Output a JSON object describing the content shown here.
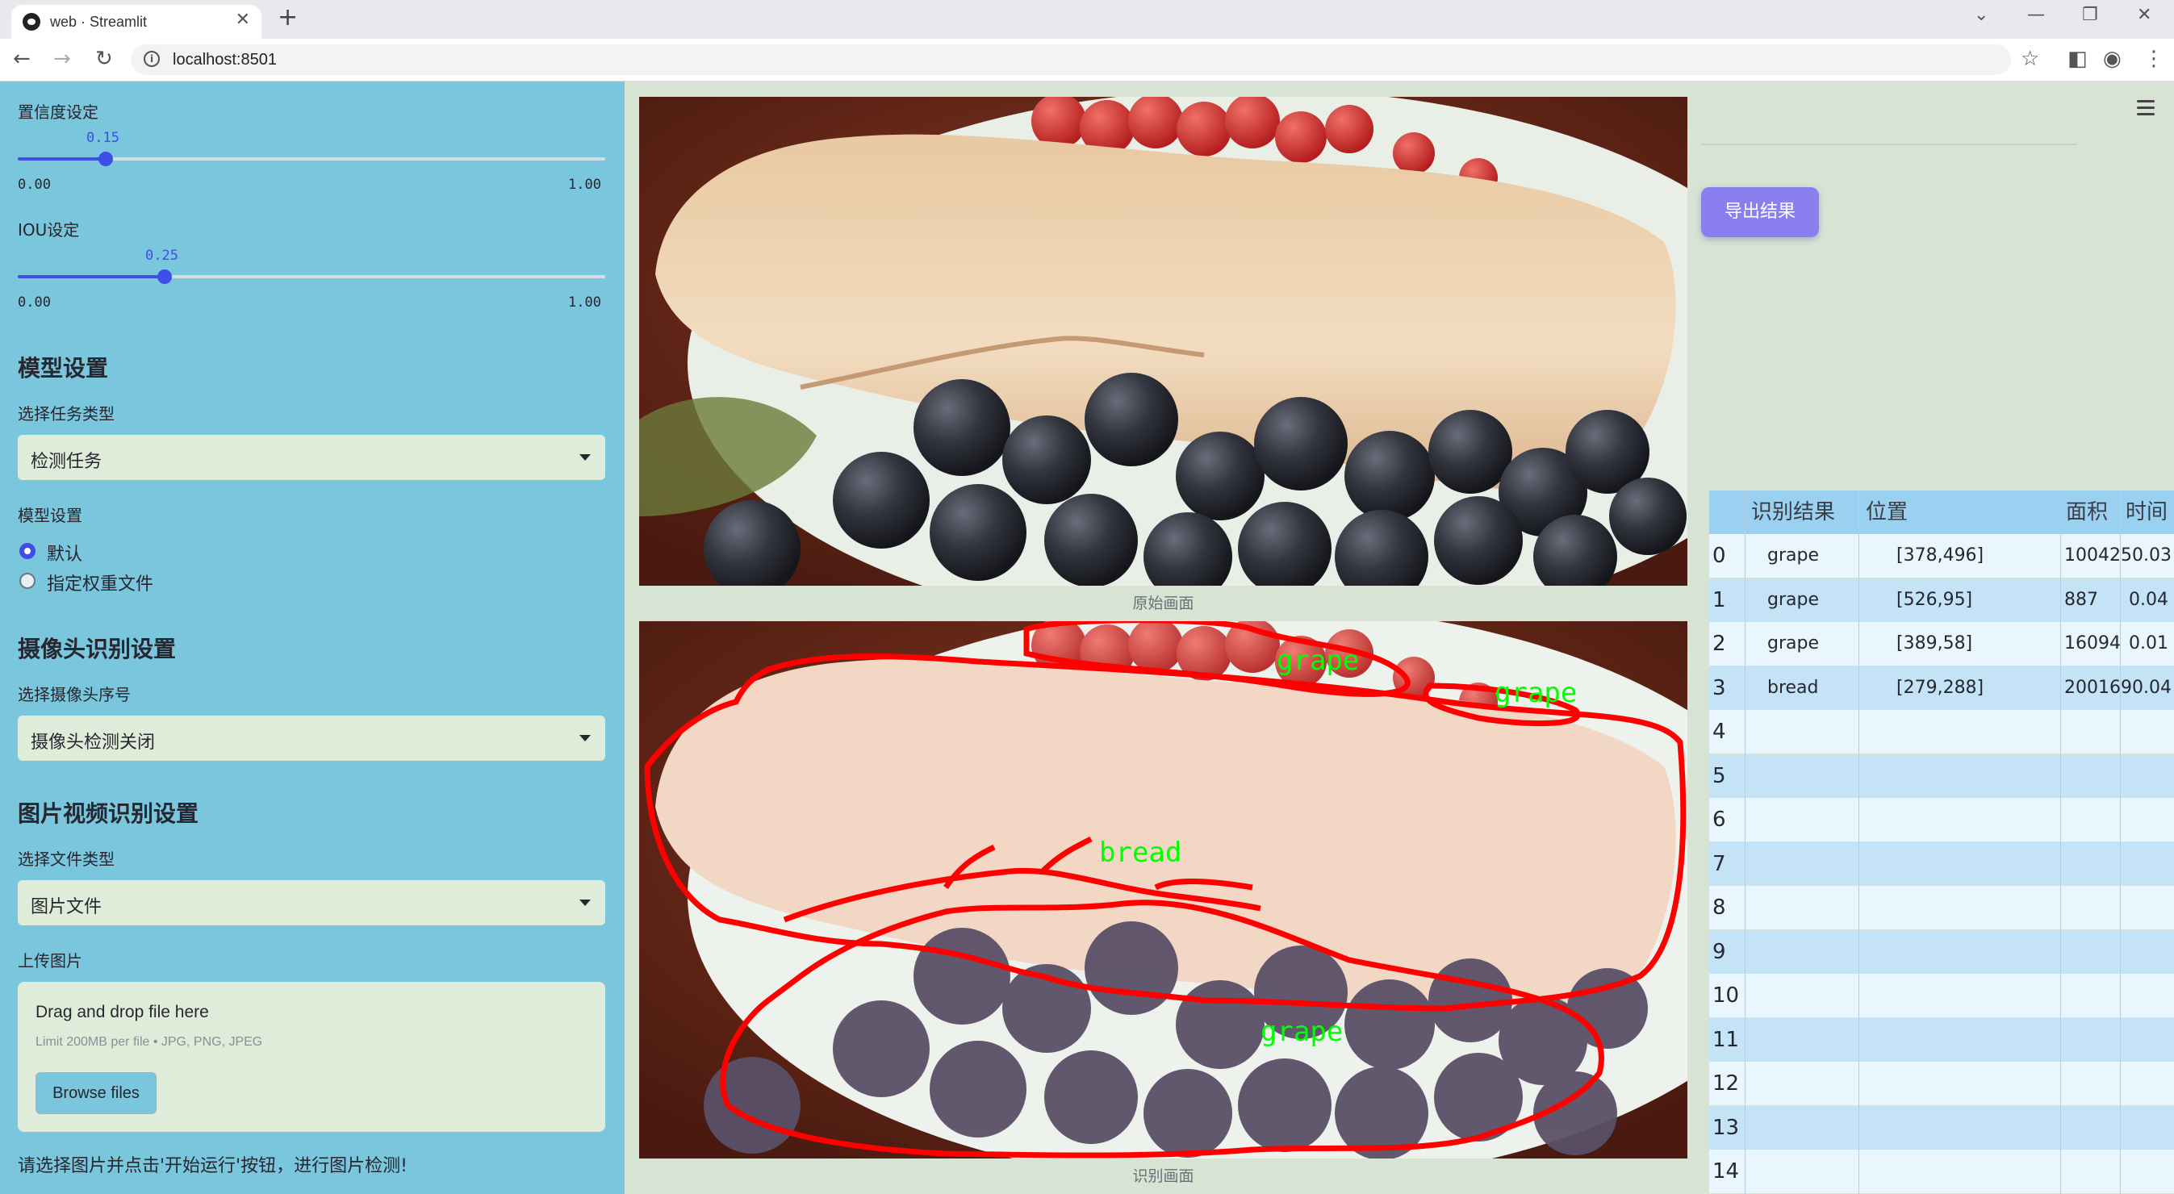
{
  "browser": {
    "tab_title": "web · Streamlit",
    "url": "localhost:8501"
  },
  "sidebar": {
    "confidence": {
      "label": "置信度设定",
      "value": "0.15",
      "min": "0.00",
      "max": "1.00",
      "fraction": 0.15
    },
    "iou": {
      "label": "IOU设定",
      "value": "0.25",
      "min": "0.00",
      "max": "1.00",
      "fraction": 0.25
    },
    "model_section": {
      "heading": "模型设置",
      "task_label": "选择任务类型",
      "task_value": "检测任务",
      "model_label": "模型设置",
      "options": [
        "默认",
        "指定权重文件"
      ],
      "selected_index": 0
    },
    "camera_section": {
      "heading": "摄像头识别设置",
      "camera_label": "选择摄像头序号",
      "camera_value": "摄像头检测关闭"
    },
    "media_section": {
      "heading": "图片视频识别设置",
      "file_type_label": "选择文件类型",
      "file_type_value": "图片文件",
      "upload_label": "上传图片",
      "drop_text": "Drag and drop file here",
      "limit_text": "Limit 200MB per file • JPG, PNG, JPEG",
      "browse_label": "Browse files"
    },
    "footer": "请选择图片并点击'开始运行'按钮，进行图片检测!"
  },
  "main": {
    "original_caption": "原始画面",
    "result_caption": "识别画面",
    "detections_labels": [
      "grape",
      "grape",
      "bread",
      "grape"
    ],
    "export_label": "导出结果",
    "table": {
      "columns": [
        "识别结果",
        "位置",
        "面积",
        "时间"
      ],
      "rows": [
        {
          "idx": "0",
          "result": "grape",
          "pos": "[378,496]",
          "area": "1004250.03",
          "time": ""
        },
        {
          "idx": "1",
          "result": "grape",
          "pos": "[526,95]",
          "area": "887",
          "time": "0.04"
        },
        {
          "idx": "2",
          "result": "grape",
          "pos": "[389,58]",
          "area": "16094",
          "time": "0.01"
        },
        {
          "idx": "3",
          "result": "bread",
          "pos": "[279,288]",
          "area": "2001690.04",
          "time": ""
        },
        {
          "idx": "4",
          "result": "",
          "pos": "",
          "area": "",
          "time": ""
        },
        {
          "idx": "5",
          "result": "",
          "pos": "",
          "area": "",
          "time": ""
        },
        {
          "idx": "6",
          "result": "",
          "pos": "",
          "area": "",
          "time": ""
        },
        {
          "idx": "7",
          "result": "",
          "pos": "",
          "area": "",
          "time": ""
        },
        {
          "idx": "8",
          "result": "",
          "pos": "",
          "area": "",
          "time": ""
        },
        {
          "idx": "9",
          "result": "",
          "pos": "",
          "area": "",
          "time": ""
        },
        {
          "idx": "10",
          "result": "",
          "pos": "",
          "area": "",
          "time": ""
        },
        {
          "idx": "11",
          "result": "",
          "pos": "",
          "area": "",
          "time": ""
        },
        {
          "idx": "12",
          "result": "",
          "pos": "",
          "area": "",
          "time": ""
        },
        {
          "idx": "13",
          "result": "",
          "pos": "",
          "area": "",
          "time": ""
        },
        {
          "idx": "14",
          "result": "",
          "pos": "",
          "area": "",
          "time": ""
        }
      ]
    }
  },
  "colors": {
    "sidebar_bg": "#7ac6dc",
    "main_bg": "#d7e4d3",
    "accent": "#3f4ee6",
    "export_button": "#8b7ff0",
    "mask_outline": "#ff0000",
    "mask_label": "#00ff00"
  }
}
